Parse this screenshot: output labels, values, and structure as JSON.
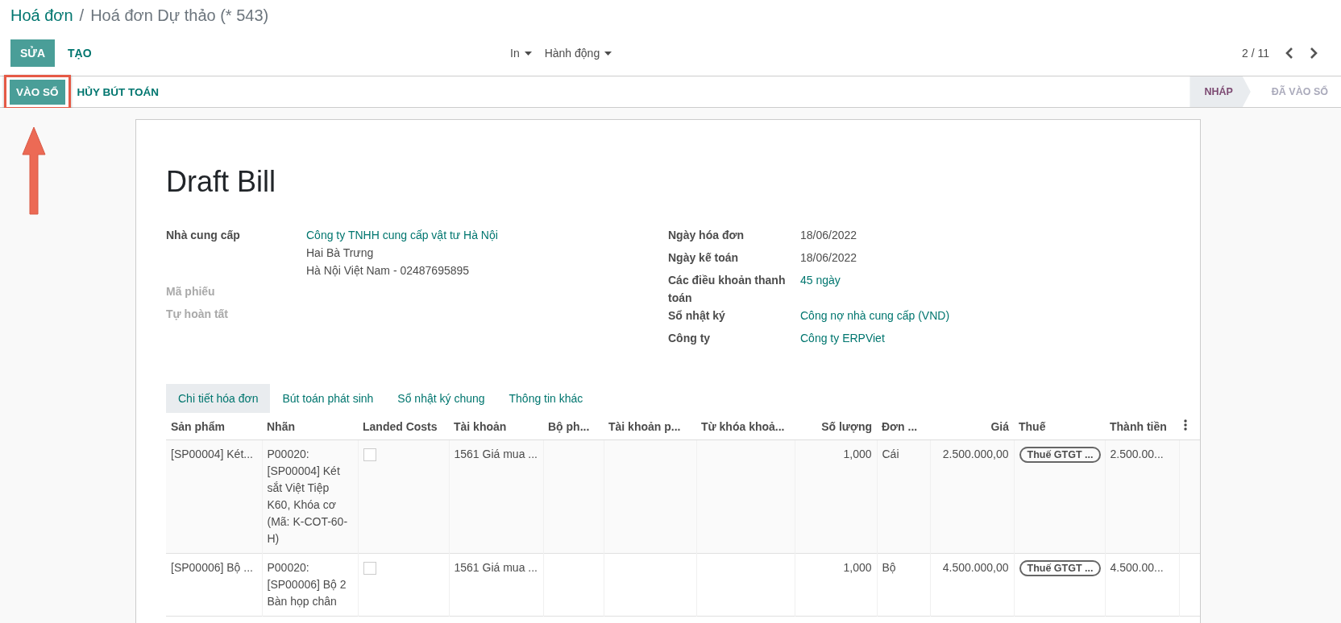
{
  "breadcrumb": {
    "parent": "Hoá đơn",
    "separator": "/",
    "current": "Hoá đơn Dự thảo (* 543)"
  },
  "buttons": {
    "edit": "SỬA",
    "create": "TẠO"
  },
  "dropdowns": [
    "In",
    "Hành động"
  ],
  "pager": "2 / 11",
  "actions": {
    "post": "VÀO SỔ",
    "cancel": "HỦY BÚT TOÁN"
  },
  "statuses": [
    {
      "label": "NHÁP",
      "selected": true
    },
    {
      "label": "ĐÃ VÀO SỔ",
      "selected": false
    }
  ],
  "annotation": {
    "kind": "arrow"
  },
  "title": "Draft Bill",
  "vendor": {
    "label": "Nhà cung cấp",
    "name": "Công ty TNHH cung cấp vật tư Hà Nội",
    "address": [
      "Hai Bà Trưng",
      "Hà Nội Việt Nam - 02487695895"
    ]
  },
  "empty_fields": [
    "Mã phiếu",
    "Tự hoàn tất"
  ],
  "right_fields": [
    {
      "label": "Ngày hóa đơn",
      "value": "18/06/2022",
      "kind": "text"
    },
    {
      "label": "Ngày kế toán",
      "value": "18/06/2022",
      "kind": "text"
    },
    {
      "label": "Các điều khoản thanh toán",
      "value": "45 ngày",
      "kind": "link"
    },
    {
      "label": "Sổ nhật ký",
      "value": "Công nợ nhà cung cấp (VND)",
      "kind": "link"
    },
    {
      "label": "Công ty",
      "value": "Công ty ERPViet",
      "kind": "link"
    }
  ],
  "tabs": [
    {
      "label": "Chi tiết hóa đơn",
      "selected": true
    },
    {
      "label": "Bút toán phát sinh",
      "selected": false
    },
    {
      "label": "Sổ nhật ký chung",
      "selected": false
    },
    {
      "label": "Thông tin khác",
      "selected": false
    }
  ],
  "table": {
    "columns": [
      "Sản phẩm",
      "Nhãn",
      "Landed Costs",
      "Tài khoản",
      "Bộ ph...",
      "Tài khoản p...",
      "Từ khóa khoả...",
      "Số lượng",
      "Đơn ...",
      "Giá",
      "Thuế",
      "Thành tiền"
    ],
    "rows": [
      {
        "product": "[SP00004] Két...",
        "label": "P00020: [SP00004] Két sắt Việt Tiệp K60, Khóa cơ (Mã: K-COT-60-H)",
        "landed_costs": false,
        "account": "1561 Giá mua ...",
        "quantity": "1,000",
        "unit": "Cái",
        "price": "2.500.000,00",
        "tax": "Thuế GTGT ...",
        "subtotal": "2.500.00..."
      },
      {
        "product": "[SP00006] Bộ ...",
        "label": "P00020: [SP00006] Bộ 2 Bàn họp chân",
        "landed_costs": false,
        "account": "1561 Giá mua ...",
        "quantity": "1,000",
        "unit": "Bộ",
        "price": "4.500.000,00",
        "tax": "Thuế GTGT ...",
        "subtotal": "4.500.00..."
      }
    ]
  }
}
